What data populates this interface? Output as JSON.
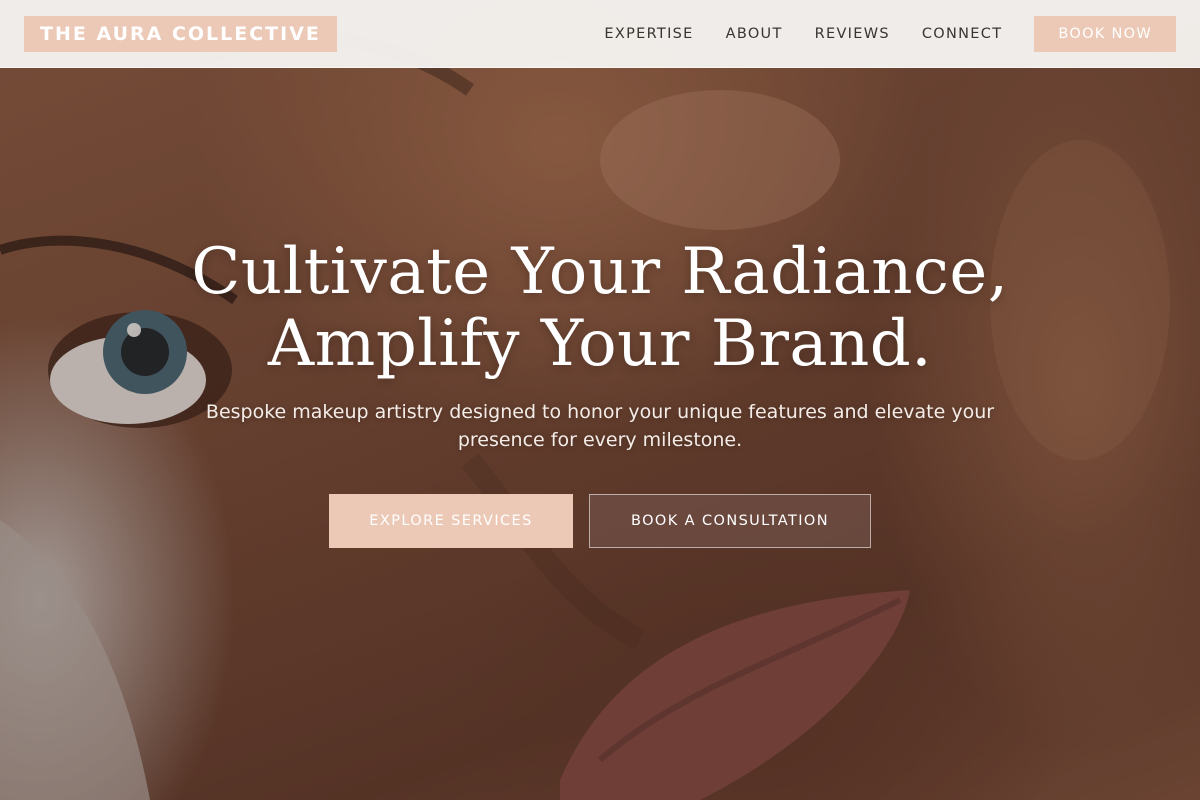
{
  "header": {
    "logo_text": "THE AURA COLLECTIVE",
    "nav": [
      {
        "label": "EXPERTISE"
      },
      {
        "label": "ABOUT"
      },
      {
        "label": "REVIEWS"
      },
      {
        "label": "CONNECT"
      }
    ],
    "cta_label": "BOOK NOW"
  },
  "hero": {
    "title_line1": "Cultivate Your Radiance,",
    "title_line2": "Amplify Your Brand.",
    "subtitle": "Bespoke makeup artistry designed to honor your unique features and elevate your presence for every milestone.",
    "primary_button": "EXPLORE SERVICES",
    "secondary_button": "BOOK A CONSULTATION"
  },
  "colors": {
    "accent": "#ecc9b6",
    "header_bg": "#f8f6f4",
    "nav_text": "#3a3431",
    "hero_text": "#ffffff"
  }
}
